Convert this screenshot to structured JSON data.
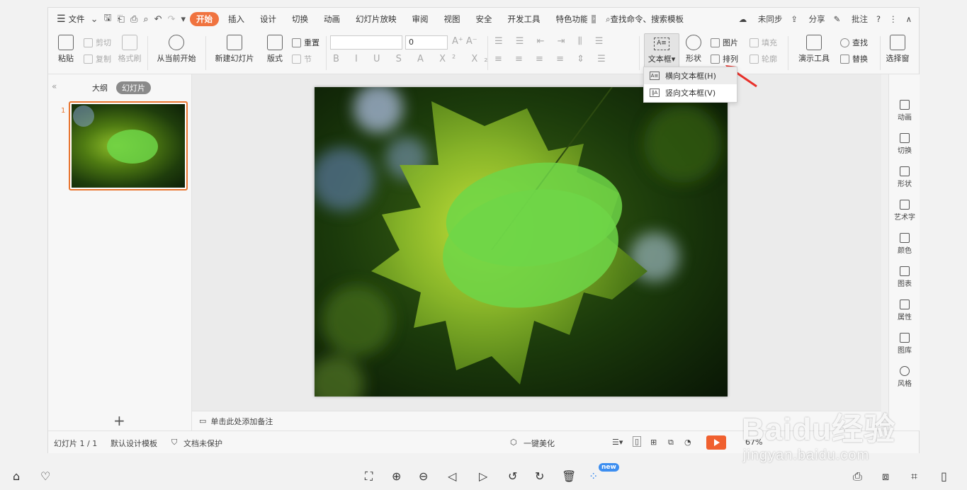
{
  "titlebar": {
    "file_menu": "文件",
    "tabs": [
      "开始",
      "插入",
      "设计",
      "切换",
      "动画",
      "幻灯片放映",
      "审阅",
      "视图",
      "安全",
      "开发工具",
      "特色功能"
    ],
    "search": "查找命令、搜索模板",
    "sync": "未同步",
    "share": "分享",
    "comment": "批注"
  },
  "ribbon": {
    "paste": "粘贴",
    "cut": "剪切",
    "copy": "复制",
    "format_painter": "格式刷",
    "from_current": "从当前开始",
    "new_slide": "新建幻灯片",
    "layout": "版式",
    "reset": "重置",
    "section": "节",
    "font_size": "0",
    "textbox": "文本框",
    "shape": "形状",
    "picture": "图片",
    "fill": "填充",
    "arrange": "排列",
    "outline": "轮廓",
    "present_tools": "演示工具",
    "find": "查找",
    "replace": "替换",
    "select_pane": "选择窗"
  },
  "dropdown": {
    "items": [
      "横向文本框(H)",
      "竖向文本框(V)"
    ]
  },
  "left_panel": {
    "outline_tab": "大纲",
    "slides_tab": "幻灯片",
    "slide_number": "1"
  },
  "notes": {
    "placeholder": "单击此处添加备注"
  },
  "right_sidebar": [
    "动画",
    "切换",
    "形状",
    "艺术字",
    "颜色",
    "图表",
    "属性",
    "图库",
    "风格"
  ],
  "status": {
    "slide_count": "幻灯片 1 / 1",
    "template": "默认设计模板",
    "protection": "文档未保护",
    "beautify": "一键美化",
    "zoom": "67%"
  },
  "bottom": {
    "badge": "new"
  },
  "watermark": {
    "brand": "Baidu经验",
    "url": "jingyan.baidu.com"
  },
  "colors": {
    "accent": "#f0733f",
    "slide_ellipse": "#6fd648",
    "annotation_arrow": "#e8302a"
  }
}
